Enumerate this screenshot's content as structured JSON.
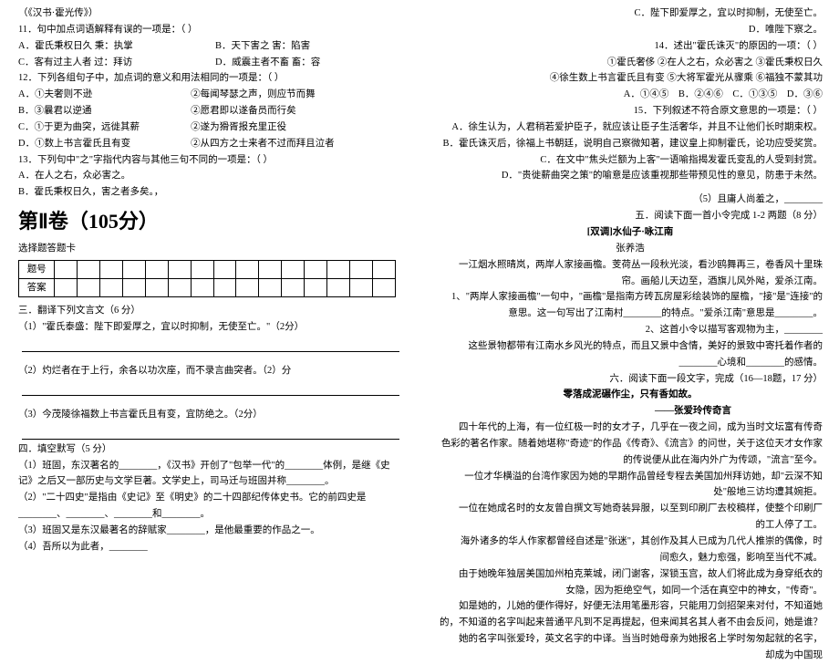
{
  "left": {
    "source": "（《汉书·霍光传》）",
    "q11": "11．句中加点词语解释有误的一项是：（   ）",
    "q11a": "A．霍氏秉权日久  秉：执掌",
    "q11b": "B．天下害之  害：陷害",
    "q11c": "C．客有过主人者  过：拜访",
    "q11d": "D．威震主者不畜  畜：容",
    "q12": "12．下列各组句子中，加点词的意义和用法相同的一项是：（   ）",
    "q12a1": "A．①夫奢则不逊",
    "q12a2": "②每闻琴瑟之声，则应节而舞",
    "q12b1": "B．③曩君以逆通",
    "q12b2": "②愿君即以遂备员而行矣",
    "q12c1": "C．①于更为曲突，远徙其薪",
    "q12c2": "②遂为猾胥报充里正役",
    "q12d1": "D．①数上书言霍氏且有变",
    "q12d2": "②从四方之士来者不过而拜且泣者",
    "q13": "13．下列句中\"之\"字指代内容与其他三句不同的一项是：（   ）",
    "q13a": "A．在人之右，众必害之。",
    "q13b": "B．霍氏秉权日久，害之者多矣。，",
    "q13c": "C．陛下即爱厚之，宜以时抑制，无使至亡。",
    "q13d": "D．唯陛下察之。",
    "q14": "14．述出\"霍氏诛灭\"的原因的一项：（   ）",
    "q14_1": "①霍氏奢侈  ②在人之右，众必害之  ③霍氏秉权日久",
    "q14_2": "④徐生数上书言霍氏且有变  ⑤大将军霍光从骤乘  ⑥福独不蒙其功",
    "q14a": "A．①④⑤",
    "q14b": "B．②④⑥",
    "q14c": "C．①③⑤",
    "q14d": "D．③⑥",
    "q15": "15．下列叙述不符合原文意思的一项是：（   ）",
    "q15a": "A．徐生认为，人君稍若爱护臣子，就应该让臣子生活奢华，并且不让他们长时期束权。",
    "q15b": "B．霍氏诛灭后，徐福上书朝廷，说明自己察微知著，建议皇上抑制霍氏，论功应受奖赏。",
    "q15c": "C．在文中\"焦头烂额为上客\"一语喻指揭发霍氏变乱的人受到封赏。",
    "q15d": "D．\"贵徙薪曲突之策\"的喻意是应该重视那些带预见性的意见，防患于未然。",
    "juan2": "第Ⅱ卷（105分）",
    "ans": "选择题答题卡",
    "row1": "题号",
    "row2": "答案",
    "s3": "三．翻译下列文言文（6 分）",
    "s3_1": "（1）\"霍氏泰盛：陛下即爱厚之，宜以时抑制，无使至亡。\"（2分）",
    "s3_2": "（2）灼烂者在于上行，余各以功次座，而不录言曲突者。（2）分",
    "s3_3": "（3）今茂陵徐福数上书言霍氏且有变，宜防绝之。（2分）",
    "s4": "四．填空默写（5 分）",
    "s4_1a": "（1）班固，东汉著名的________，《汉书》开创了\"包举一代\"的________体例，是继《史记》之后又一部历史与文学巨著。文学史上，司马迁与班固并称________。",
    "s4_2": "（2）\"二十四史\"是指由《史记》至《明史》的二十四部纪传体史书。它的前四史是________、________、________和________。",
    "s4_3": "（3）班固又是东汉最著名的辞赋家________，是他最重要的作品之一。",
    "s4_4": "（4）吾所以为此者，________",
    "s4_5": "（5）且庸人尚羞之，________"
  },
  "right": {
    "s5": "五．阅读下面一首小令完成 1-2 两题（8 分）",
    "poem_title": "[双调]水仙子·咏江南",
    "poem_author": "张养浩",
    "poem_body": "一江烟水照晴岚，两岸人家接画檐。芰荷丛一段秋光淡，看沙鸥舞再三，卷香风十里珠帘。画船儿天边至，酒旗儿风外飐，爱杀江南。",
    "p1a": "1、\"两岸人家接画檐\"一句中，\"画檐\"是指南方砖瓦房屋彩绘装饰的屋檐，\"接\"是\"连接\"的意思。这一句写出了江南村________的特点。\"爱杀江南\"意思是________。",
    "p2a": "2、这首小令以描写客观物为主，________",
    "p2b": "这些景物都带有江南水乡风光的特点，而且又景中含情，美好的景致中寄托着作者的________心境和________的感情。",
    "s6": "六．阅读下面一段文字，完成（16—18题，17 分）",
    "art_title": "零落成泥碾作尘，只有香如故。",
    "art_sub": "——张爱玲传奇言",
    "para1": "四十年代的上海，有一位红极一时的女才子，几乎在一夜之间，成为当时文坛富有传奇色彩的著名作家。随着她堪称\"奇迹\"的作品《传奇》、《流言》的问世，关于这位天才女作家的传说便从此在海内外广为传颂，\"流言\"至今。",
    "para2": "一位才华横溢的台湾作家因为她的早期作品曾经专程去美国加州拜访她，却\"云深不知处\"般地三访均遭其婉拒。",
    "para3": "一位在她成名时的女友曾自撰文写她奇装异服，以至到印刷厂去校稿样，使整个印刷厂的工人停了工。",
    "para4": "海外诸多的华人作家都曾经自述是\"张迷\"，其创作及其人已成为几代人推崇的偶像，时间愈久，魅力愈强，影响至当代不减。",
    "para5": "由于她晚年独居美国加州柏克莱城，闭门谢客，深锁玉宫，故人们将此成为身穿纸衣的女隐，因为拒绝空气，如同一个活在真空中的神女，\"传奇\"。",
    "para6": "如是她的，儿她的便作得好，好便无法用笔墨形容，只能用刀剑招架来对付，不知道她的，不知道的名字叫起来普通平凡到不足再提起，但来闻其名其人者不由会反问，她是谁？",
    "para7": "她的名字叫张爱玲，英文名字的中译。当当时她母亲为她报名上学时匆匆起就的名字，却成为中国现"
  }
}
